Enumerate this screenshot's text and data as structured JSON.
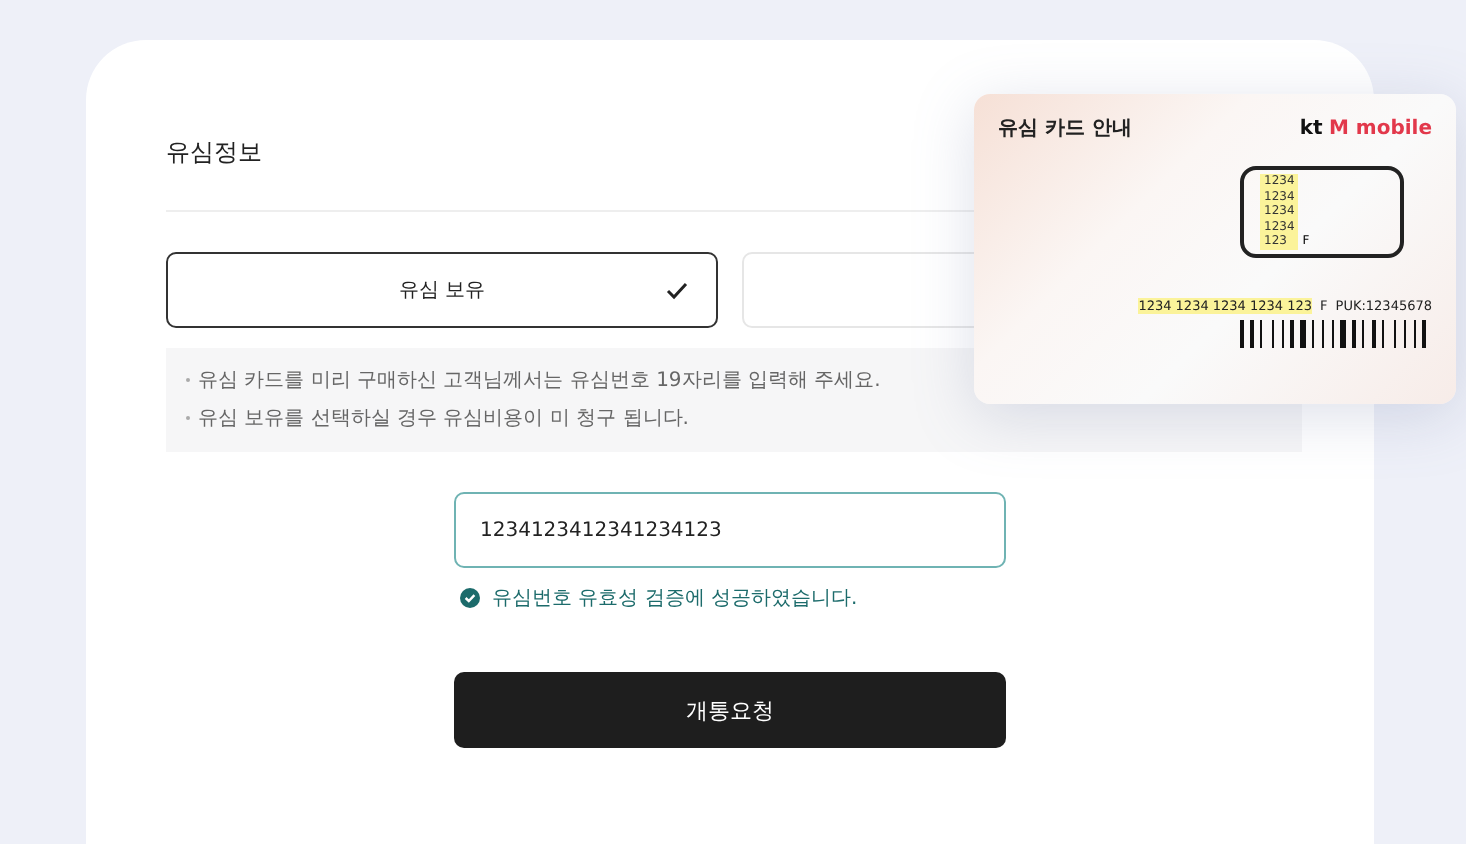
{
  "section_title": "유심정보",
  "options": [
    {
      "label": "유심 보유",
      "selected": true
    },
    {
      "selected": false
    }
  ],
  "notes": [
    "유심 카드를 미리 구매하신 고객님께서는 유심번호 19자리를 입력해 주세요.",
    "유심 보유를 선택하실 경우 유심비용이 미 청구 됩니다."
  ],
  "sim_number_field": {
    "value": "1234123412341234123"
  },
  "validation": {
    "valid": true,
    "message": "유심번호 유효성 검증에 성공하였습니다."
  },
  "submit_button": "개통요청",
  "sim_card_guide": {
    "title": "유심 카드 안내",
    "logo_prefix": "kt",
    "logo_name": "M mobile",
    "chip_numbers": [
      "1234",
      "1234",
      "1234",
      "1234",
      "123"
    ],
    "chip_suffix": "F",
    "number_highlight": "1234 1234 1234 1234 123",
    "number_suffix": "F",
    "puk": "PUK:12345678"
  }
}
